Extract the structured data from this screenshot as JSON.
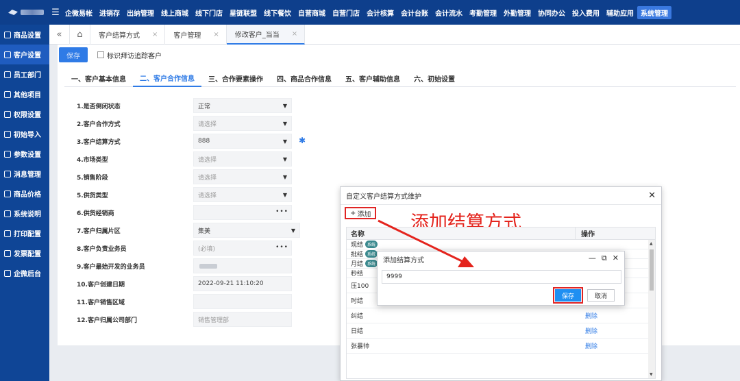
{
  "topnav": {
    "items": [
      "企微易帐",
      "进销存",
      "出纳管理",
      "线上商城",
      "线下门店",
      "星链联盟",
      "线下餐饮",
      "自营商城",
      "自营门店",
      "会计核算",
      "会计台账",
      "会计流水",
      "考勤管理",
      "外勤管理",
      "协同办公",
      "投入费用",
      "辅助应用",
      "系统管理"
    ],
    "active": "系统管理"
  },
  "sidebar": {
    "items": [
      "商品设置",
      "客户设置",
      "员工部门",
      "其他项目",
      "权限设置",
      "初始导入",
      "参数设置",
      "消息管理",
      "商品价格",
      "系统说明",
      "打印配置",
      "发票配置",
      "企微后台"
    ]
  },
  "tabs": {
    "items": [
      "客户结算方式",
      "客户管理",
      "修改客户_当当"
    ]
  },
  "toolbar": {
    "save_label": "保存",
    "checkbox_label": "标识拜访追踪客户"
  },
  "section_tabs": [
    "一、客户基本信息",
    "二、客户合作信息",
    "三、合作要素操作",
    "四、商品合作信息",
    "五、客户辅助信息",
    "六、初始设置"
  ],
  "form": {
    "rows": [
      {
        "label": "1.是否倒闭状态",
        "value": "正常"
      },
      {
        "label": "2.客户合作方式",
        "value": "请选择"
      },
      {
        "label": "3.客户结算方式",
        "value": "888"
      },
      {
        "label": "4.市场类型",
        "value": "请选择"
      },
      {
        "label": "5.销售阶段",
        "value": "请选择"
      },
      {
        "label": "5.供货类型",
        "value": "请选择"
      },
      {
        "label": "6.供货经销商",
        "value": ""
      },
      {
        "label": "7.客户归属片区",
        "value": "集美"
      },
      {
        "label": "8.客户负责业务员",
        "value": "(必填)"
      },
      {
        "label": "9.客户最始开发的业务员",
        "value": ""
      },
      {
        "label": "10.客户创建日期",
        "value": "2022-09-21 11:10:20"
      },
      {
        "label": "11.客户销售区域",
        "value": ""
      },
      {
        "label": "12.客户归属公司部门",
        "value": "销售管理部"
      }
    ]
  },
  "maint_dialog": {
    "title": "自定义客户结算方式维护",
    "add_label": "添加",
    "annotation": "添加结算方式",
    "col_name": "名称",
    "col_action": "操作",
    "sys_tag": "系统",
    "rows": [
      {
        "name": "现结",
        "sys": true,
        "action": ""
      },
      {
        "name": "批结",
        "sys": true,
        "action": ""
      },
      {
        "name": "月结",
        "sys": true,
        "action": ""
      },
      {
        "name": "秒结",
        "sys": false,
        "action": ""
      },
      {
        "name": "压100",
        "sys": false,
        "action": ""
      },
      {
        "name": "时结",
        "sys": false,
        "action": "删除"
      },
      {
        "name": "纠结",
        "sys": false,
        "action": "删除"
      },
      {
        "name": "日结",
        "sys": false,
        "action": "删除"
      },
      {
        "name": "张暴帅",
        "sys": false,
        "action": "删除"
      }
    ]
  },
  "add_dialog": {
    "title": "添加结算方式",
    "input_value": "9999",
    "save_label": "保存",
    "cancel_label": "取消"
  },
  "colors": {
    "nav": "#0e3f8c",
    "sidebar": "#0f4596",
    "accent": "#2f7be6",
    "annotation": "#e4241d"
  }
}
